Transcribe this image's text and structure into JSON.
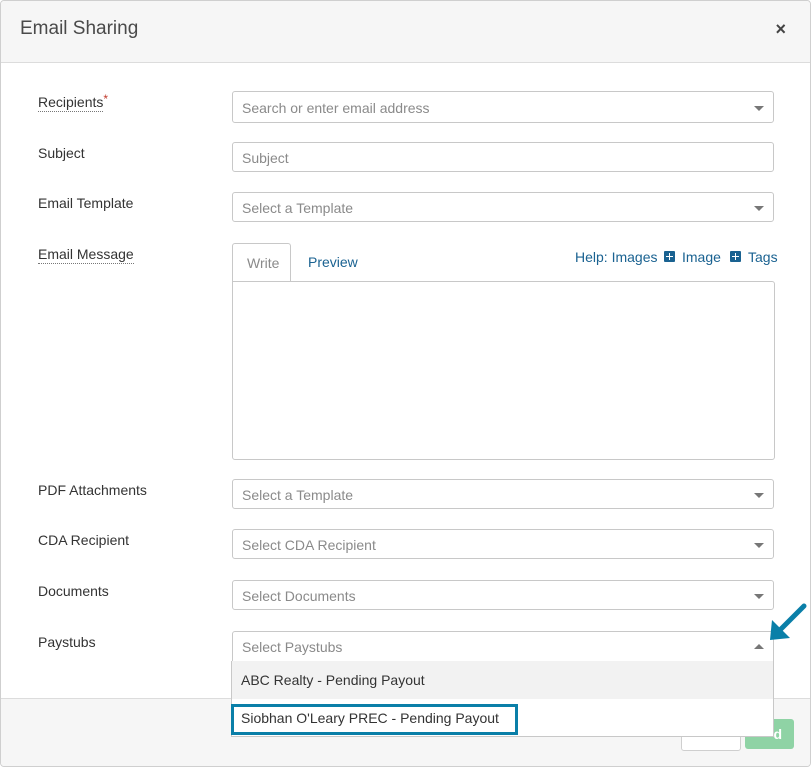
{
  "dialog": {
    "title": "Email Sharing",
    "close_glyph": "×"
  },
  "fields": {
    "recipients": {
      "label": "Recipients",
      "required_mark": "*",
      "placeholder": "Search or enter email address"
    },
    "subject": {
      "label": "Subject",
      "placeholder": "Subject"
    },
    "email_template": {
      "label": "Email Template",
      "placeholder": "Select a Template"
    },
    "email_message": {
      "label": "Email Message",
      "tab_write": "Write",
      "tab_preview": "Preview",
      "help_images": "Help: Images",
      "image_link": "Image",
      "tags_link": "Tags"
    },
    "pdf_attachments": {
      "label": "PDF Attachments",
      "placeholder": "Select a Template"
    },
    "cda_recipient": {
      "label": "CDA Recipient",
      "placeholder": "Select CDA Recipient"
    },
    "documents": {
      "label": "Documents",
      "placeholder": "Select Documents"
    },
    "paystubs": {
      "label": "Paystubs",
      "placeholder": "Select Paystubs",
      "options": [
        "ABC Realty - Pending Payout",
        "Siobhan O'Leary PREC - Pending Payout"
      ]
    }
  },
  "footer": {
    "send_label": "d"
  },
  "colors": {
    "link": "#1a6291",
    "highlight": "#0a7fa8",
    "send_button": "#8fd3a5"
  }
}
